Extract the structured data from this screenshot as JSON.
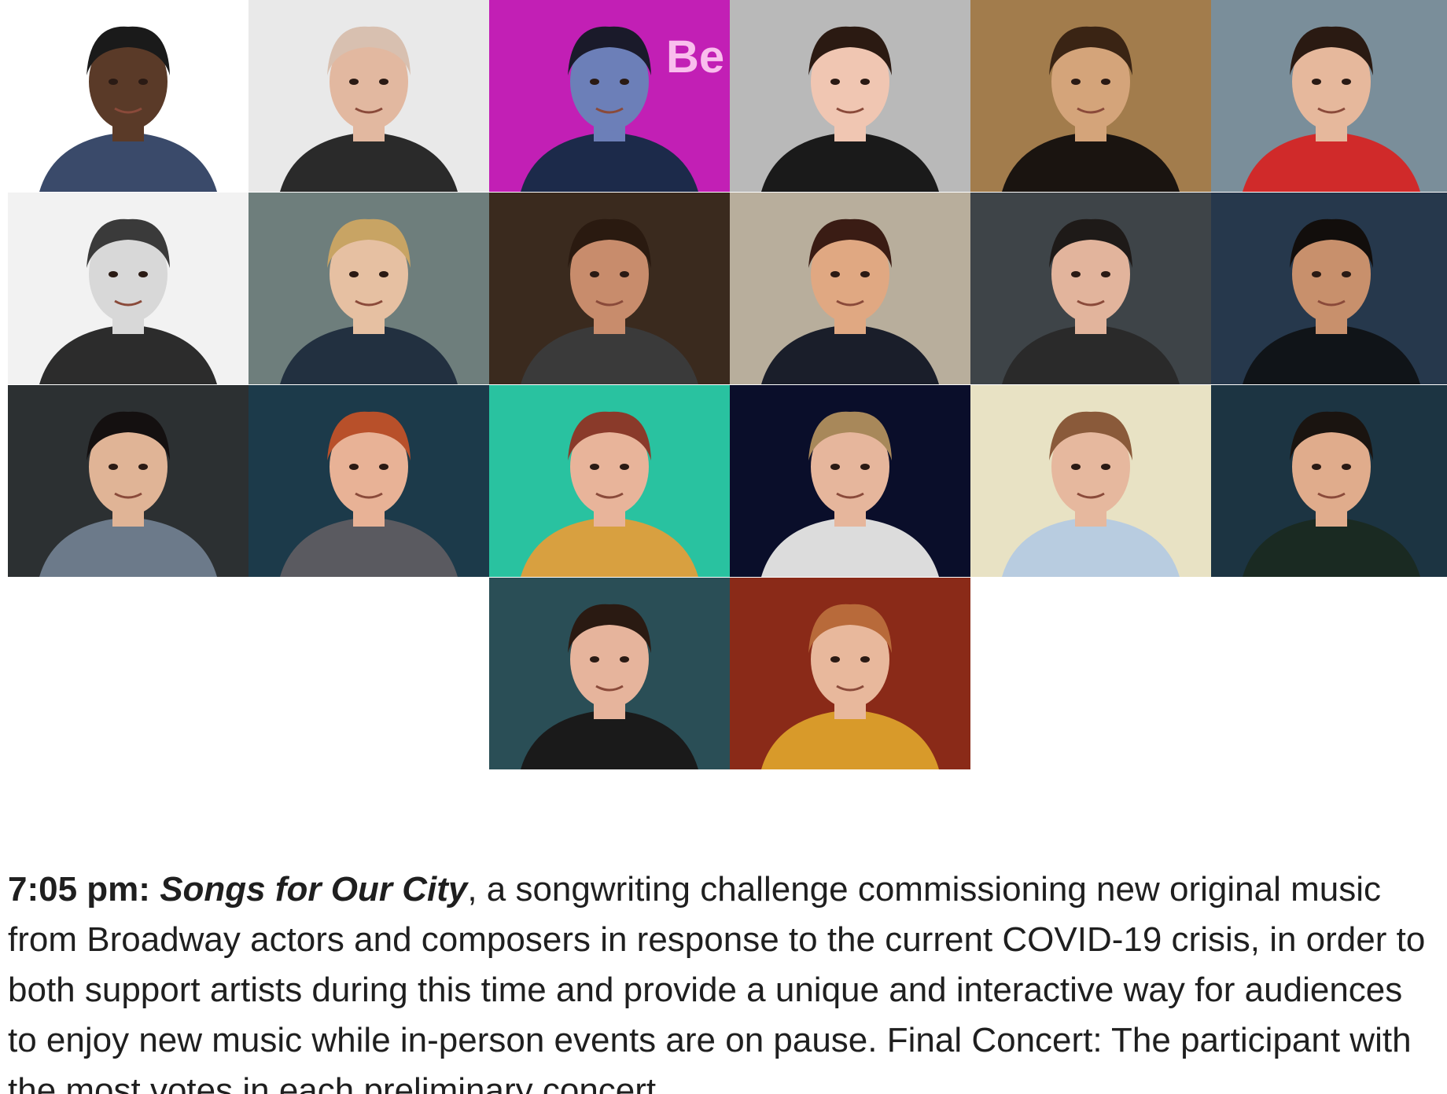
{
  "article": {
    "time_label": "7:05 pm:",
    "event_title": "Songs for Our City",
    "description": ", a songwriting challenge commissioning new original music from Broadway actors and composers in response to the current COVID-19 crisis, in order to both support artists during this time and provide a unique and interactive way for audiences to enjoy new music while in-person events are on pause. Final Concert: The participant with the most votes in each preliminary concert"
  },
  "photo_grid": {
    "rows": 4,
    "columns": 6,
    "sign_text": "Be",
    "tiles": [
      {
        "bg": "#ffffff",
        "skin": "#5a3a28",
        "hair": "#1a1a1a",
        "shirt": "#3a4a6a"
      },
      {
        "bg": "#e9e9e9",
        "skin": "#e2b8a0",
        "hair": "#d8c0b0",
        "shirt": "#2a2a2a"
      },
      {
        "bg": "#c21fb5",
        "skin": "#6c7fb8",
        "hair": "#1a1a2a",
        "shirt": "#1c2a4a"
      },
      {
        "bg": "#b9b9b9",
        "skin": "#f0c6b2",
        "hair": "#2b1a12",
        "shirt": "#1a1a1a"
      },
      {
        "bg": "#a27c4c",
        "skin": "#d4a47a",
        "hair": "#3a2414",
        "shirt": "#1a1410"
      },
      {
        "bg": "#7a8e9a",
        "skin": "#e6b89c",
        "hair": "#2a1a12",
        "shirt": "#d02a2a"
      },
      {
        "bg": "#f2f2f2",
        "skin": "#d8d8d8",
        "hair": "#3a3a3a",
        "shirt": "#2c2c2c"
      },
      {
        "bg": "#6e7e7c",
        "skin": "#e6c0a2",
        "hair": "#c8a464",
        "shirt": "#223040"
      },
      {
        "bg": "#3a2a1e",
        "skin": "#c88c6c",
        "hair": "#2a1a10",
        "shirt": "#3a3a3a"
      },
      {
        "bg": "#b8ae9c",
        "skin": "#e0a882",
        "hair": "#3a1c14",
        "shirt": "#1a1e2a"
      },
      {
        "bg": "#3e4448",
        "skin": "#e2b49c",
        "hair": "#1e1a18",
        "shirt": "#2a2a2a"
      },
      {
        "bg": "#26384c",
        "skin": "#c8906c",
        "hair": "#120e0c",
        "shirt": "#101418"
      },
      {
        "bg": "#2c3032",
        "skin": "#e0b496",
        "hair": "#141010",
        "shirt": "#6c7a8a"
      },
      {
        "bg": "#1c3a4a",
        "skin": "#e8b296",
        "hair": "#b8502a",
        "shirt": "#5a5a60"
      },
      {
        "bg": "#29c2a0",
        "skin": "#e8b49a",
        "hair": "#8a3a2a",
        "shirt": "#d8a040"
      },
      {
        "bg": "#0a0e2a",
        "skin": "#e6b69c",
        "hair": "#a8885a",
        "shirt": "#dcdcdc"
      },
      {
        "bg": "#e8e2c4",
        "skin": "#e6b89e",
        "hair": "#8a5a3a",
        "shirt": "#b8cce0"
      },
      {
        "bg": "#1c3442",
        "skin": "#e0ac8c",
        "hair": "#1a1410",
        "shirt": "#1a2a22"
      },
      {
        "bg": "#2a4e56",
        "skin": "#e6b49c",
        "hair": "#2a1a12",
        "shirt": "#1a1a1a"
      },
      {
        "bg": "#8a2a18",
        "skin": "#e8b89c",
        "hair": "#b86a3a",
        "shirt": "#d89a2a"
      }
    ]
  }
}
